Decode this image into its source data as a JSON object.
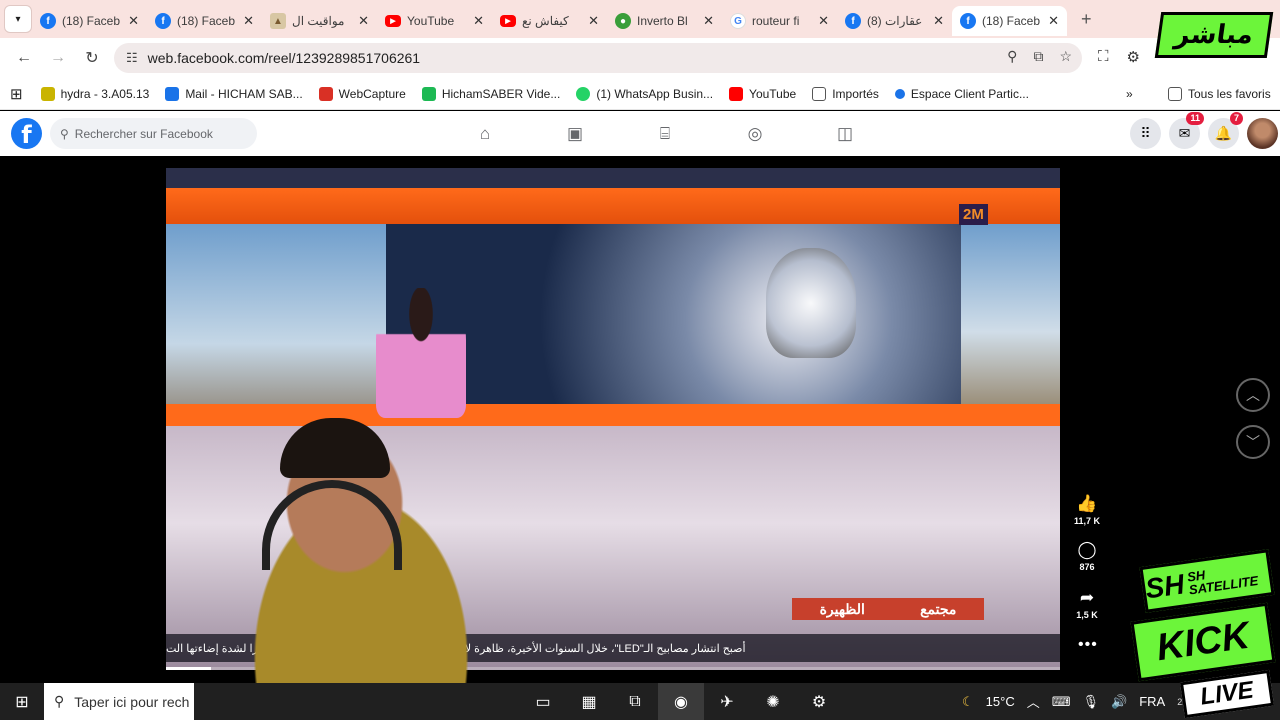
{
  "browser": {
    "tabs": [
      {
        "title": "(18) Faceb",
        "icon": "facebook-icon"
      },
      {
        "title": "(18) Faceb",
        "icon": "facebook-icon"
      },
      {
        "title": "مواقيت ال",
        "icon": "mosque-icon"
      },
      {
        "title": "YouTube",
        "icon": "youtube-icon"
      },
      {
        "title": "كيفاش نع",
        "icon": "youtube-icon"
      },
      {
        "title": "Inverto Bl",
        "icon": "green-circle-icon"
      },
      {
        "title": "routeur fi",
        "icon": "google-icon"
      },
      {
        "title": "(8) عقارات",
        "icon": "facebook-icon"
      },
      {
        "title": "(18) Faceb",
        "icon": "facebook-icon",
        "active": true
      }
    ],
    "url": "web.facebook.com/reel/1239289851706261",
    "bookmarks": [
      {
        "label": "hydra - 3.A05.13",
        "color": "#c9b400"
      },
      {
        "label": "Mail - HICHAM SAB...",
        "color": "#1a73e8"
      },
      {
        "label": "WebCapture",
        "color": "#d93025"
      },
      {
        "label": "HichamSABER Vide...",
        "color": "#1db954"
      },
      {
        "label": "(1) WhatsApp Busin...",
        "color": "#25d366"
      },
      {
        "label": "YouTube",
        "color": "#ff0000"
      },
      {
        "label": "Importés",
        "color": "#555555"
      },
      {
        "label": "Espace Client Partic...",
        "color": "#1a73e8"
      }
    ],
    "all_bookmarks": "Tous les favoris"
  },
  "facebook": {
    "search_placeholder": "Rechercher sur Facebook",
    "messenger_badge": "11",
    "notifications_badge": "7"
  },
  "reel": {
    "channel_logo": "2M",
    "lower_third": [
      "الظهيرة",
      "مجتمع"
    ],
    "ticker": "أصبح انتشار مصابيح الـ\"LED\"، خلال السنوات الأخيرة، ظاهرة لافتة على الطرقات، إلا أنها تظل غير معتمدة نظرا لشدة إضاءتها الت",
    "likes": "11,7 K",
    "comments": "876",
    "shares": "1,5 K",
    "progress": 0.05
  },
  "overlay": {
    "live_badge": "مباشر",
    "kick_sh": "SH",
    "kick_sat": "SH SATELLITE",
    "kick": "KICK",
    "live": "LIVE"
  },
  "taskbar": {
    "search_placeholder": "Taper ici pour rech",
    "weather": "15°C",
    "language": "FRA",
    "clock": "22"
  }
}
